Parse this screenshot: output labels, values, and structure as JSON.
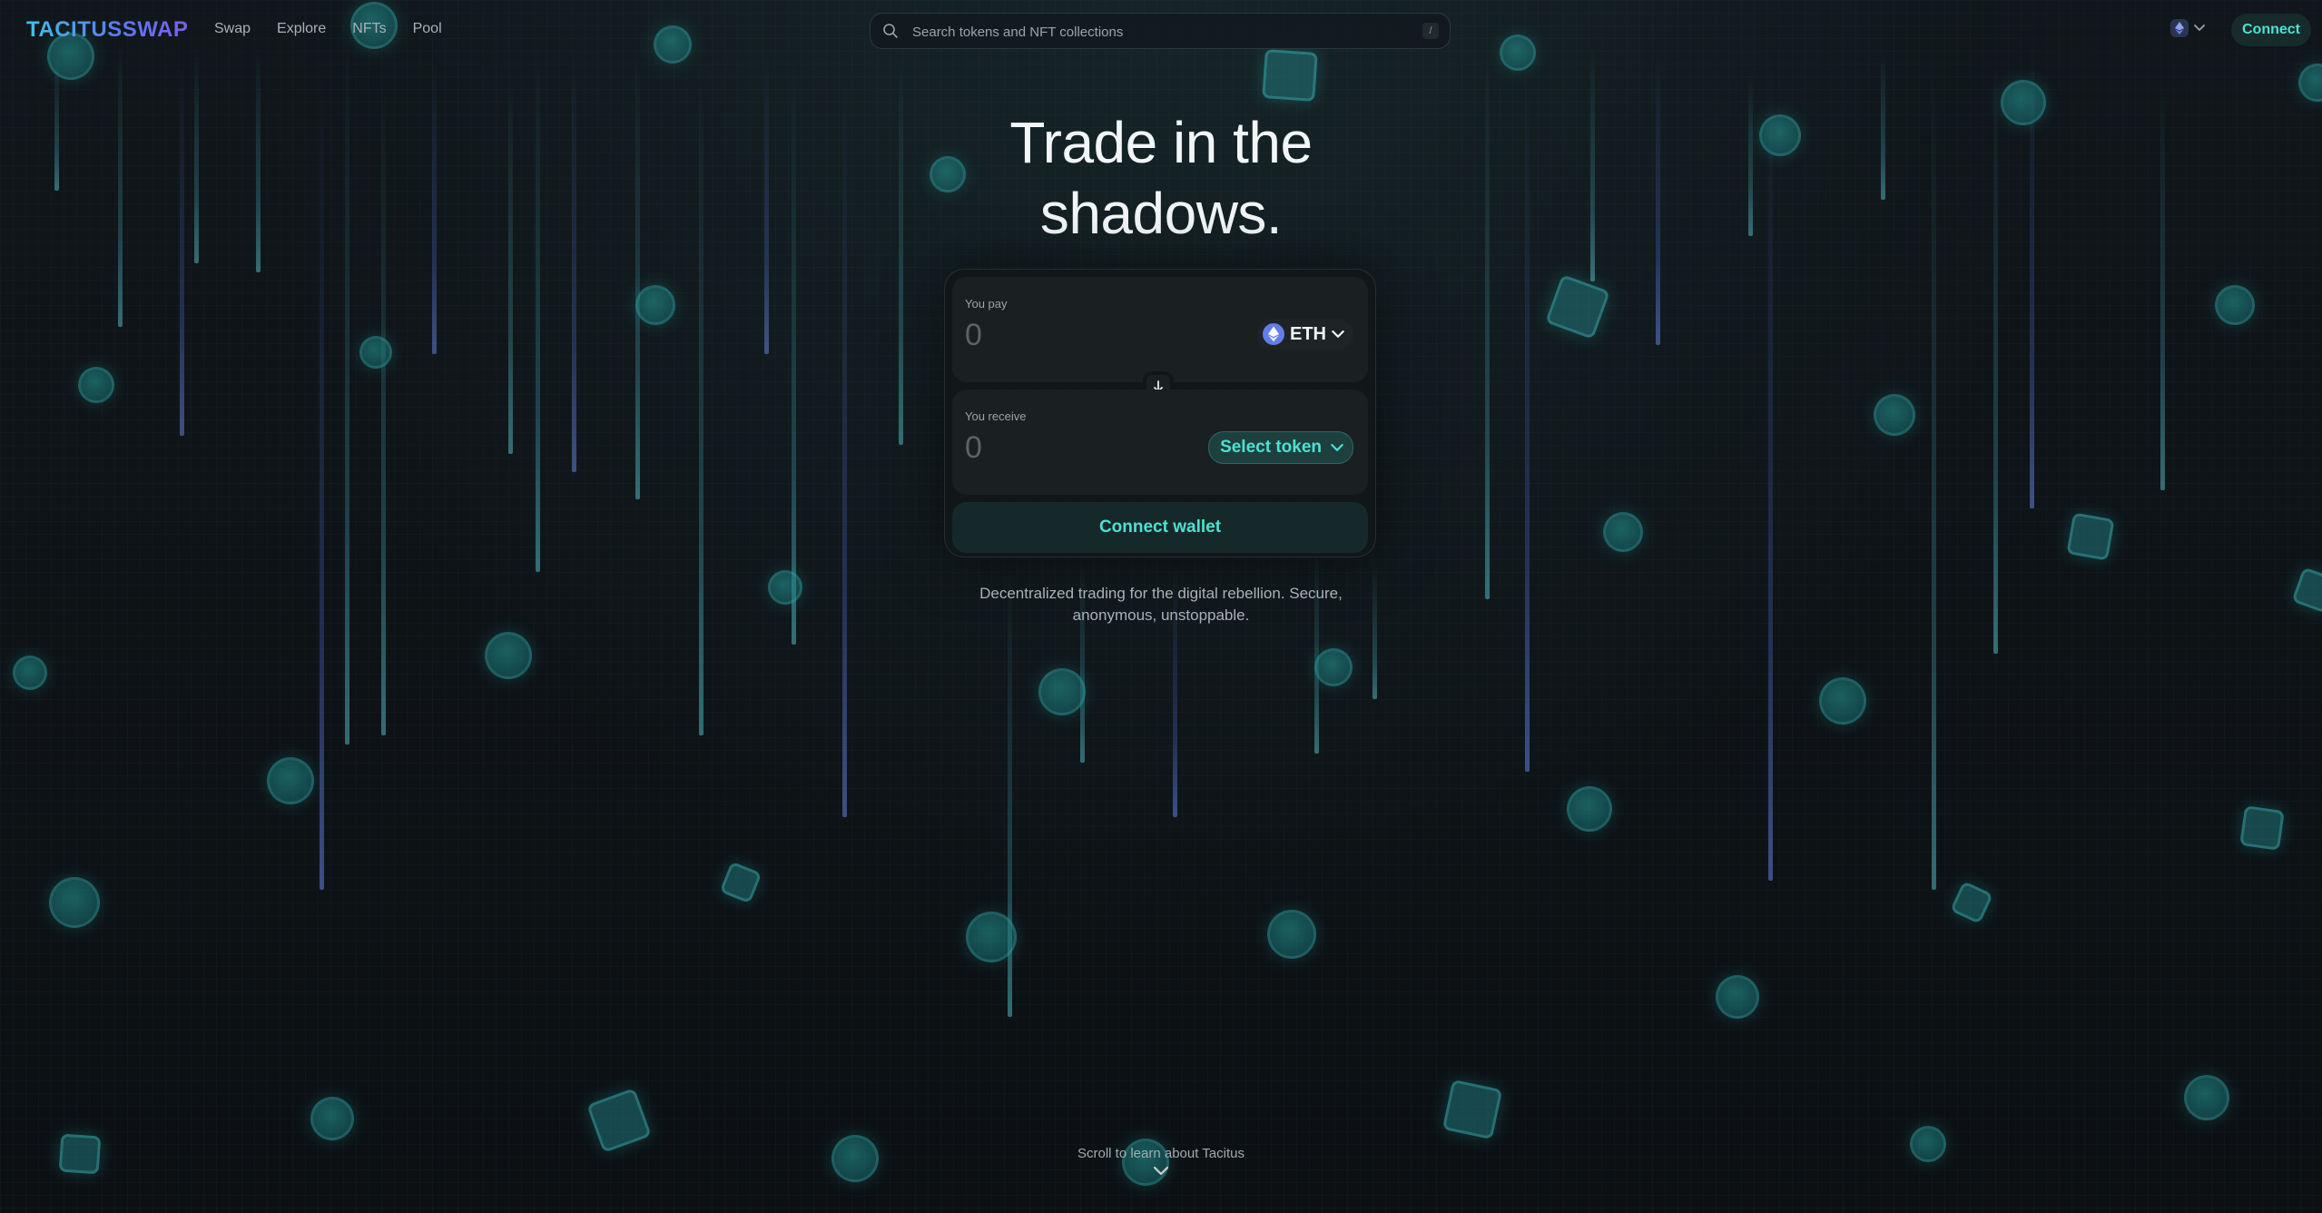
{
  "header": {
    "logo": "TACITUSSWAP",
    "nav": [
      "Swap",
      "Explore",
      "NFTs",
      "Pool"
    ],
    "search_placeholder": "Search tokens and NFT collections",
    "search_shortcut": "/",
    "network_icon": "ethereum-icon",
    "connect_label": "Connect"
  },
  "hero": {
    "line1": "Trade in the",
    "line2": "shadows."
  },
  "swap": {
    "pay_label": "You pay",
    "pay_amount_placeholder": "0",
    "pay_token": "ETH",
    "receive_label": "You receive",
    "receive_amount_placeholder": "0",
    "receive_token": "Select token",
    "connect_wallet_label": "Connect wallet"
  },
  "tagline": "Decentralized trading for the digital rebellion. Secure, anonymous, unstoppable.",
  "scroll_hint": "Scroll to learn about Tacitus",
  "colors": {
    "accent": "#4fe0d0",
    "background": "#0d1114",
    "eth": "#627eea"
  }
}
